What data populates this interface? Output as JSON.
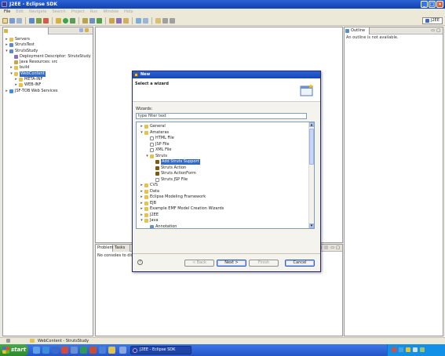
{
  "window": {
    "title": "J2EE - Eclipse SDK"
  },
  "menubar": {
    "items": [
      "File",
      "Edit",
      "Navigate",
      "Search",
      "Project",
      "Run",
      "Window",
      "Help"
    ]
  },
  "perspective": {
    "label": "J2EE"
  },
  "explorer": {
    "tab_label": "",
    "tree": [
      {
        "label": "Servers",
        "depth": 0,
        "twisty": "+",
        "icon": "folder"
      },
      {
        "label": "StrutsTest",
        "depth": 0,
        "twisty": "+",
        "icon": "project"
      },
      {
        "label": "StrutsStudy",
        "depth": 0,
        "twisty": "-",
        "icon": "project"
      },
      {
        "label": "Deployment Descriptor: StrutsStudy",
        "depth": 1,
        "twisty": "",
        "icon": "descriptor"
      },
      {
        "label": "Java Resources: src",
        "depth": 1,
        "twisty": "",
        "icon": "package"
      },
      {
        "label": "build",
        "depth": 1,
        "twisty": "+",
        "icon": "folder"
      },
      {
        "label": "WebContent",
        "depth": 1,
        "twisty": "-",
        "icon": "folder",
        "selected": true
      },
      {
        "label": "META-INF",
        "depth": 2,
        "twisty": "+",
        "icon": "folder"
      },
      {
        "label": "WEB-INF",
        "depth": 2,
        "twisty": "+",
        "icon": "folder"
      },
      {
        "label": "JSF-TOB Web Services",
        "depth": 0,
        "twisty": "+",
        "icon": "service"
      }
    ]
  },
  "outline": {
    "tab_label": "Outline",
    "message": "An outline is not available."
  },
  "problems": {
    "tab_labels": [
      "Problems",
      "Tasks"
    ],
    "message": "No consoles to display"
  },
  "dialog": {
    "title": "New",
    "heading": "Select a wizard",
    "wizards_label": "Wizards:",
    "filter_value": "type filter text",
    "tree": [
      {
        "label": "General",
        "depth": 0,
        "twisty": "+",
        "icon": "folder"
      },
      {
        "label": "Amateras",
        "depth": 0,
        "twisty": "-",
        "icon": "folder"
      },
      {
        "label": "HTML File",
        "depth": 1,
        "twisty": "",
        "icon": "file"
      },
      {
        "label": "JSP File",
        "depth": 1,
        "twisty": "",
        "icon": "file"
      },
      {
        "label": "XML File",
        "depth": 1,
        "twisty": "",
        "icon": "file"
      },
      {
        "label": "Struts",
        "depth": 1,
        "twisty": "-",
        "icon": "folder"
      },
      {
        "label": "Add Struts Support",
        "depth": 2,
        "twisty": "",
        "icon": "gear",
        "selected": true
      },
      {
        "label": "Struts Action",
        "depth": 2,
        "twisty": "",
        "icon": "gear"
      },
      {
        "label": "Struts ActionForm",
        "depth": 2,
        "twisty": "",
        "icon": "gear"
      },
      {
        "label": "Struts JSP File",
        "depth": 2,
        "twisty": "",
        "icon": "file"
      },
      {
        "label": "CVS",
        "depth": 0,
        "twisty": "+",
        "icon": "folder"
      },
      {
        "label": "Data",
        "depth": 0,
        "twisty": "+",
        "icon": "folder"
      },
      {
        "label": "Eclipse Modeling Framework",
        "depth": 0,
        "twisty": "+",
        "icon": "folder"
      },
      {
        "label": "EJB",
        "depth": 0,
        "twisty": "+",
        "icon": "folder"
      },
      {
        "label": "Example EMF Model Creation Wizards",
        "depth": 0,
        "twisty": "+",
        "icon": "folder"
      },
      {
        "label": "J2EE",
        "depth": 0,
        "twisty": "+",
        "icon": "folder"
      },
      {
        "label": "Java",
        "depth": 0,
        "twisty": "-",
        "icon": "folder"
      },
      {
        "label": "Annotation",
        "depth": 1,
        "twisty": "",
        "icon": "at"
      }
    ],
    "buttons": {
      "back": "< Back",
      "next": "Next >",
      "finish": "Finish",
      "cancel": "Cancel"
    }
  },
  "statusbar": {
    "text": "WebContent - StrutsStudy"
  },
  "taskbar": {
    "start_label": "start",
    "task_label": "J2EE - Eclipse SDK",
    "clock": ""
  },
  "colors": {
    "selection": "#3169c6",
    "titlebar": "#2b63d6",
    "folder": "#e3c24e"
  }
}
